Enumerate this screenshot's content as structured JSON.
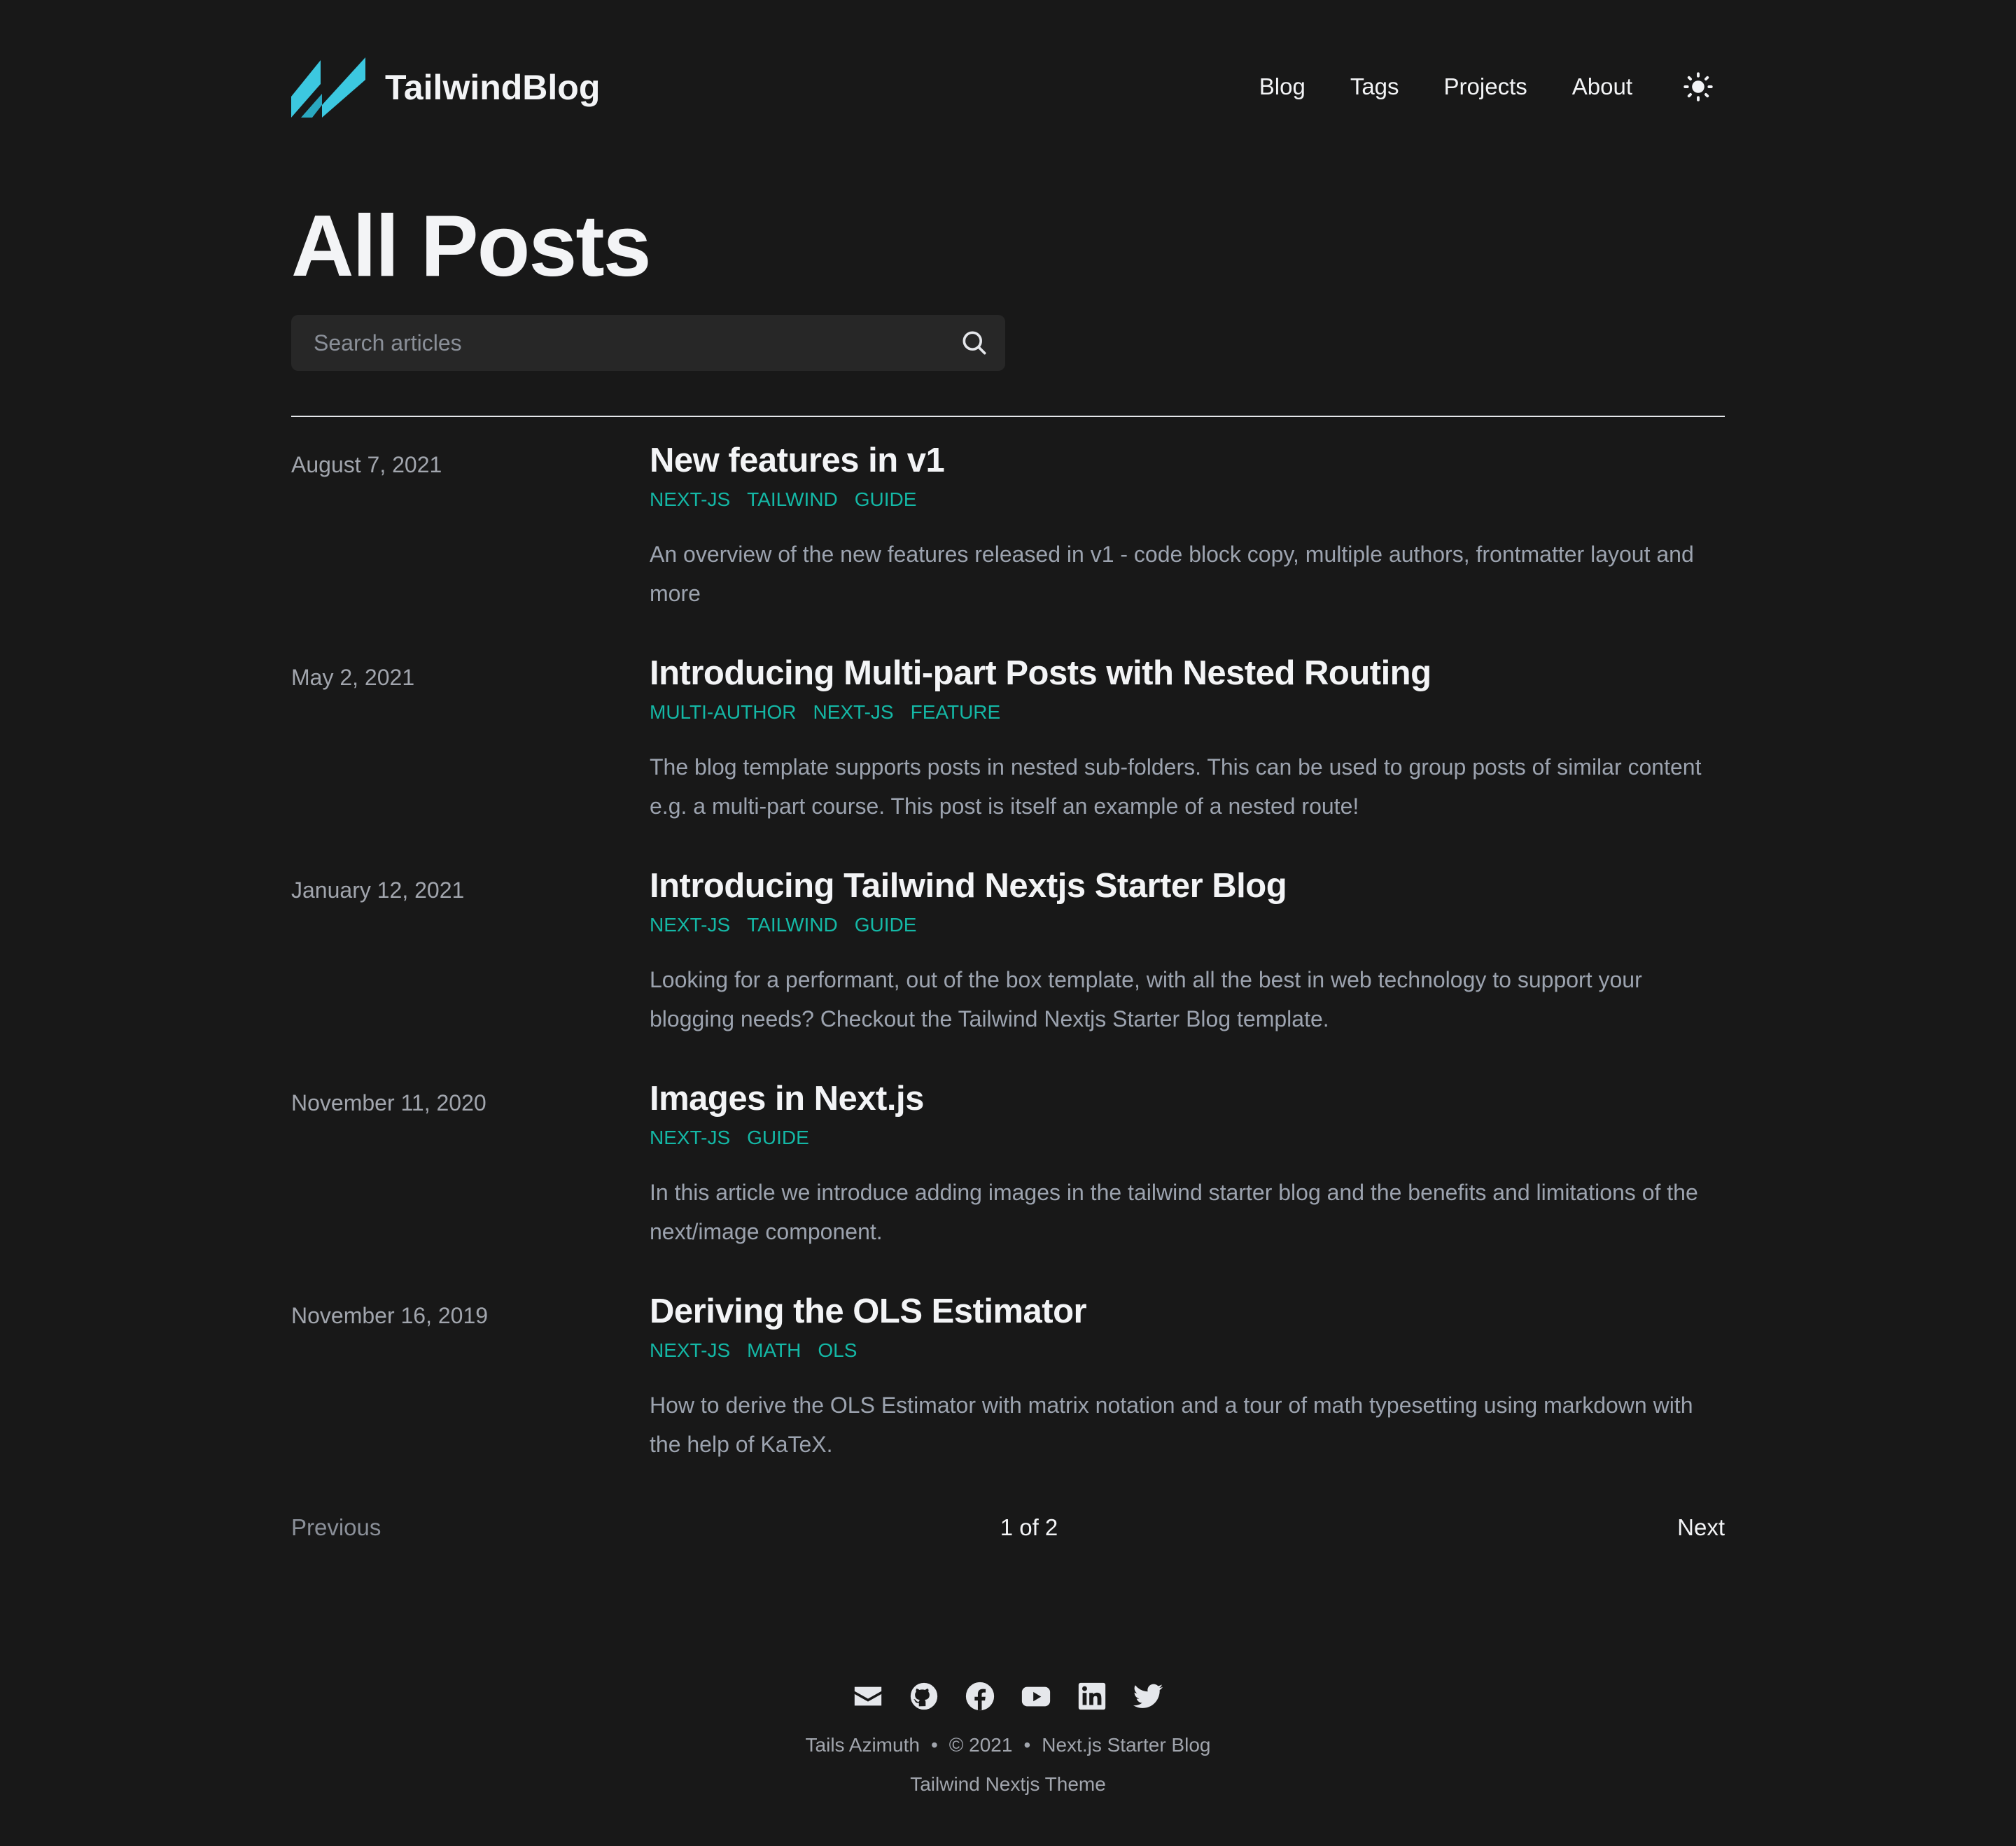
{
  "header": {
    "logo_text": "TailwindBlog",
    "nav": [
      {
        "label": "Blog"
      },
      {
        "label": "Tags"
      },
      {
        "label": "Projects"
      },
      {
        "label": "About"
      }
    ],
    "theme_icon": "sun-icon"
  },
  "main": {
    "title": "All Posts",
    "search": {
      "placeholder": "Search articles",
      "value": ""
    },
    "posts": [
      {
        "date": "August 7, 2021",
        "title": "New features in v1",
        "tags": [
          "NEXT-JS",
          "TAILWIND",
          "GUIDE"
        ],
        "summary": "An overview of the new features released in v1 - code block copy, multiple authors, frontmatter layout and more"
      },
      {
        "date": "May 2, 2021",
        "title": "Introducing Multi-part Posts with Nested Routing",
        "tags": [
          "MULTI-AUTHOR",
          "NEXT-JS",
          "FEATURE"
        ],
        "summary": "The blog template supports posts in nested sub-folders. This can be used to group posts of similar content e.g. a multi-part course. This post is itself an example of a nested route!"
      },
      {
        "date": "January 12, 2021",
        "title": "Introducing Tailwind Nextjs Starter Blog",
        "tags": [
          "NEXT-JS",
          "TAILWIND",
          "GUIDE"
        ],
        "summary": "Looking for a performant, out of the box template, with all the best in web technology to support your blogging needs? Checkout the Tailwind Nextjs Starter Blog template."
      },
      {
        "date": "November 11, 2020",
        "title": "Images in Next.js",
        "tags": [
          "NEXT-JS",
          "GUIDE"
        ],
        "summary": "In this article we introduce adding images in the tailwind starter blog and the benefits and limitations of the next/image component."
      },
      {
        "date": "November 16, 2019",
        "title": "Deriving the OLS Estimator",
        "tags": [
          "NEXT-JS",
          "MATH",
          "OLS"
        ],
        "summary": "How to derive the OLS Estimator with matrix notation and a tour of math typesetting using markdown with the help of KaTeX."
      }
    ],
    "pagination": {
      "previous": "Previous",
      "page_info": "1 of 2",
      "next": "Next"
    }
  },
  "footer": {
    "social_icons": [
      "mail-icon",
      "github-icon",
      "facebook-icon",
      "youtube-icon",
      "linkedin-icon",
      "twitter-icon"
    ],
    "author": "Tails Azimuth",
    "bullet": "•",
    "copyright": "© 2021",
    "site_title": "Next.js Starter Blog",
    "theme_credit": "Tailwind Nextjs Theme"
  },
  "colors": {
    "background": "#181818",
    "accent": "#14b8a6",
    "logo": "#3cc8e0",
    "text": "#f3f4f6",
    "muted": "#9ca3af"
  }
}
